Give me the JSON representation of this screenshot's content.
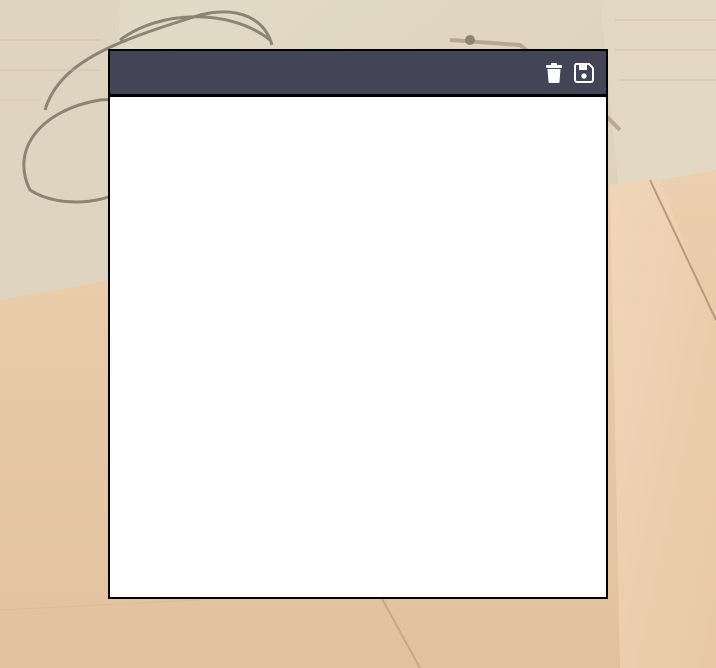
{
  "background": {
    "description_icon": "vintage-paper-glasses-background"
  },
  "note": {
    "header_color": "#434556",
    "content": "",
    "actions": {
      "delete_icon": "trash-icon",
      "save_icon": "floppy-disk-icon"
    }
  }
}
